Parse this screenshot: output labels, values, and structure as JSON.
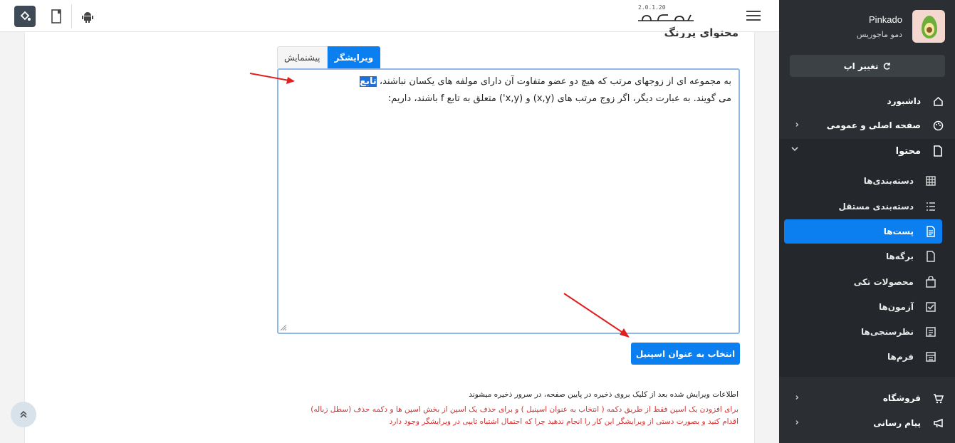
{
  "app": {
    "version": "2.0.1.20",
    "logo": "ماجوریس"
  },
  "sidebar": {
    "app_name": "Pinkado",
    "app_subtitle": "دمو ماجوریس",
    "change_app_label": "تغییر اپ",
    "menu": [
      {
        "label": "داشبورد",
        "icon": "home-icon"
      },
      {
        "label": "صفحه اصلی و عمومی",
        "icon": "palette-icon",
        "expandable": true
      },
      {
        "label": "محتوا",
        "icon": "file-icon",
        "expanded": true
      }
    ],
    "submenu": [
      {
        "label": "دسته‌بندی‌ها",
        "icon": "grid-icon"
      },
      {
        "label": "دسته‌بندی مستقل",
        "icon": "list-icon"
      },
      {
        "label": "پست‌ها",
        "icon": "document-icon",
        "active": true
      },
      {
        "label": "برگه‌ها",
        "icon": "page-icon"
      },
      {
        "label": "محصولات تکی",
        "icon": "bag-icon"
      },
      {
        "label": "آزمون‌ها",
        "icon": "checkbox-icon"
      },
      {
        "label": "نظرسنجی‌ها",
        "icon": "poll-icon"
      },
      {
        "label": "فرم‌ها",
        "icon": "form-icon"
      }
    ],
    "bottom_menu": [
      {
        "label": "فروشگاه",
        "icon": "cart-icon"
      },
      {
        "label": "پیام رسانی",
        "icon": "megaphone-icon"
      }
    ]
  },
  "content": {
    "section_title": "محتوای پررنگ",
    "tabs": {
      "editor": "ویرایشگر",
      "preview": "پیشنمایش"
    },
    "editor": {
      "line1_before": "به مجموعه ای از زوجهای مرتب که هیچ دو عضو متفاوت آن دارای مولفه های یکسان نباشند، ",
      "highlighted": "تابع",
      "line2": "می گویند. به عبارت دیگر، اگر زوج مرتب های (x,y) و (x,y') متعلق به تابع f باشند، داریم:"
    },
    "spinel_button": "انتخاب به عنوان اسپنیل",
    "notes": [
      "اطلاعات ویرایش شده بعد از کلیک بروی ذخیره در پایین صفحه، در سرور ذخیره میشوند",
      "برای افزودن یک اسپن فقط از طریق دکمه ( انتخاب به عنوان اسپنیل ) و برای حذف یک اسپن از بخش اسپن ها و دکمه حذف (سطل زباله)",
      "اقدام کنید و بصورت دستی از ویرایشگر این کار را انجام ندهید چرا که احتمال اشتباه تایپی در ویرایشگر وجود دارد"
    ]
  }
}
